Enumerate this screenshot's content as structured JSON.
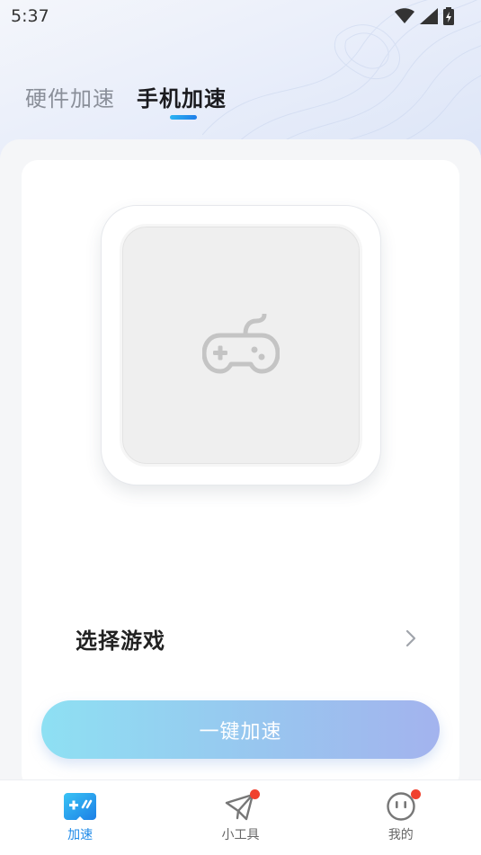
{
  "status_bar": {
    "time": "5:37",
    "icons": [
      "wifi-icon",
      "cellular-signal-icon",
      "battery-charging-icon"
    ]
  },
  "tabs": [
    {
      "label": "硬件加速",
      "active": false
    },
    {
      "label": "手机加速",
      "active": true
    }
  ],
  "game_slot": {
    "icon": "gamepad-icon"
  },
  "select_game": {
    "label": "选择游戏",
    "icon": "chevron-right-icon"
  },
  "accelerate_button": {
    "label": "一键加速"
  },
  "bottom_nav": [
    {
      "label": "加速",
      "icon": "gamepad-tile-icon",
      "active": true,
      "badge": false
    },
    {
      "label": "小工具",
      "icon": "paper-plane-icon",
      "active": false,
      "badge": true
    },
    {
      "label": "我的",
      "icon": "face-icon",
      "active": false,
      "badge": true
    }
  ],
  "colors": {
    "accent": "#1e8ae8",
    "button_gradient_start": "#8ee0f3",
    "button_gradient_end": "#a3b3ee",
    "badge": "#f0412e"
  }
}
